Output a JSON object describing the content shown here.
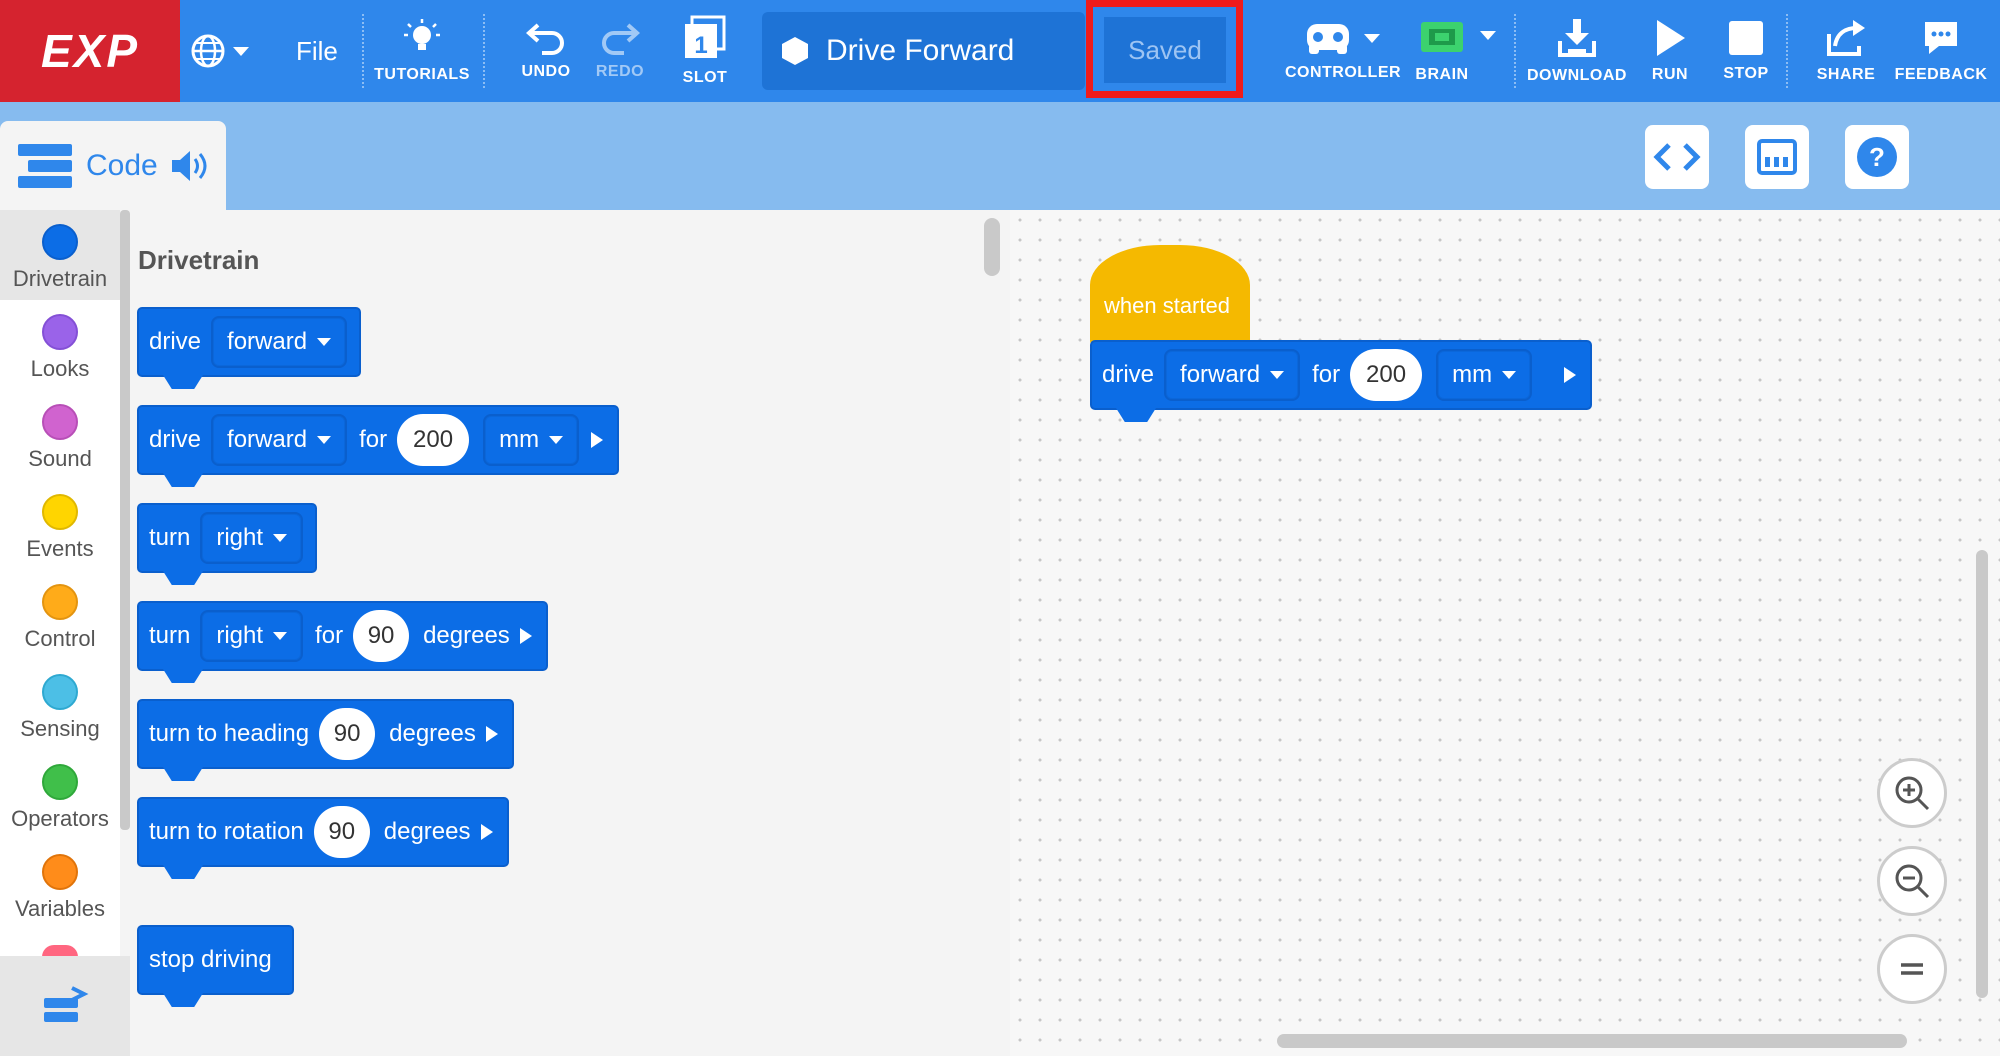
{
  "toolbar": {
    "logo": "EXP",
    "file": "File",
    "tutorials": "TUTORIALS",
    "undo": "UNDO",
    "redo": "REDO",
    "slot": "SLOT",
    "slot_number": "1",
    "project_name": "Drive Forward",
    "save_status": "Saved",
    "controller": "CONTROLLER",
    "brain": "BRAIN",
    "download": "DOWNLOAD",
    "run": "RUN",
    "stop": "STOP",
    "share": "SHARE",
    "feedback": "FEEDBACK"
  },
  "tabs": {
    "code": "Code"
  },
  "categories": [
    {
      "label": "Drivetrain",
      "color": "#0c6de6"
    },
    {
      "label": "Looks",
      "color": "#9a63e9"
    },
    {
      "label": "Sound",
      "color": "#d063cf"
    },
    {
      "label": "Events",
      "color": "#ffd500"
    },
    {
      "label": "Control",
      "color": "#ffab19"
    },
    {
      "label": "Sensing",
      "color": "#4cbfe6"
    },
    {
      "label": "Operators",
      "color": "#40bf4a"
    },
    {
      "label": "Variables",
      "color": "#ff8c1a"
    }
  ],
  "palette": {
    "title": "Drivetrain",
    "drive1": {
      "verb": "drive",
      "dir": "forward"
    },
    "drive2": {
      "verb": "drive",
      "dir": "forward",
      "for": "for",
      "value": "200",
      "unit": "mm"
    },
    "turn1": {
      "verb": "turn",
      "dir": "right"
    },
    "turn2": {
      "verb": "turn",
      "dir": "right",
      "for": "for",
      "value": "90",
      "unit": "degrees"
    },
    "heading": {
      "text": "turn to heading",
      "value": "90",
      "unit": "degrees"
    },
    "rotation": {
      "text": "turn to rotation",
      "value": "90",
      "unit": "degrees"
    },
    "stop": {
      "text": "stop driving"
    }
  },
  "workspace": {
    "hat": "when started",
    "drive": {
      "verb": "drive",
      "dir": "forward",
      "for": "for",
      "value": "200",
      "unit": "mm"
    }
  }
}
